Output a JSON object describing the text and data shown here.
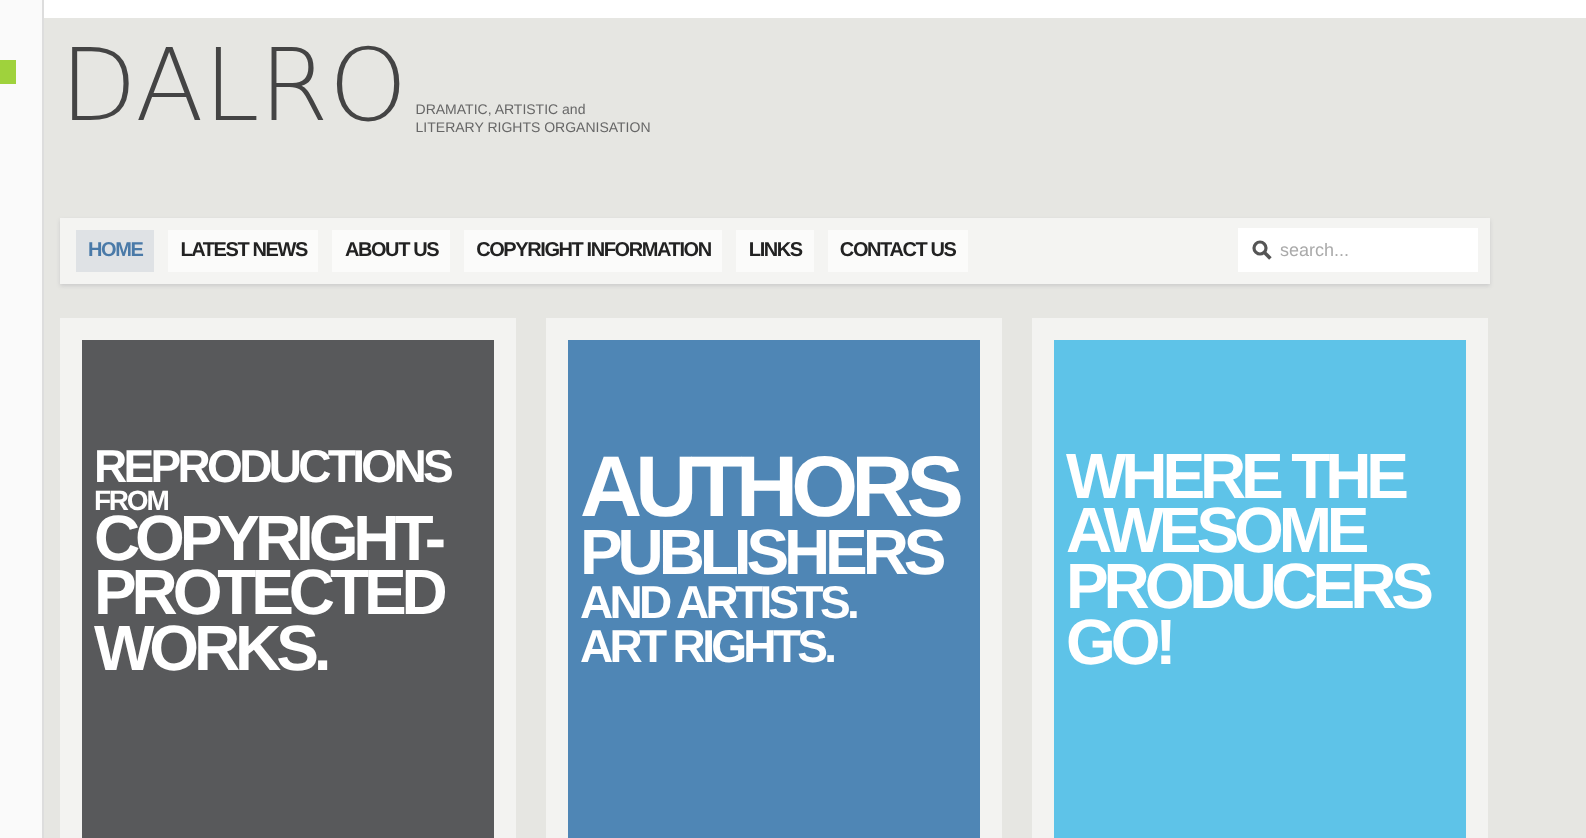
{
  "logo": {
    "text": "DALRO",
    "tagline_line_1": "DRAMATIC, ARTISTIC and",
    "tagline_line_2": "LITERARY RIGHTS ORGANISATION"
  },
  "nav": {
    "items": [
      {
        "label": "HOME",
        "selected": true
      },
      {
        "label": "LATEST NEWS",
        "selected": false
      },
      {
        "label": "ABOUT US",
        "selected": false
      },
      {
        "label": "COPYRIGHT INFORMATION",
        "selected": false
      },
      {
        "label": "LINKS",
        "selected": false
      },
      {
        "label": "CONTACT US",
        "selected": false
      }
    ],
    "search": {
      "placeholder": "search..."
    }
  },
  "posters": [
    {
      "color": "#58595b",
      "lines": [
        {
          "text": "REPRODUCTIONS",
          "kind": "medium"
        },
        {
          "text": "FROM",
          "kind": "small"
        },
        {
          "text": "COPYRIGHT-",
          "kind": "large"
        },
        {
          "text": "PROTECTED",
          "kind": "large"
        },
        {
          "text": "WORKS.",
          "kind": "large"
        }
      ]
    },
    {
      "color": "#4f86b5",
      "lines": [
        {
          "text": "AUTHORS",
          "kind": "huge"
        },
        {
          "text": "PUBLISHERS",
          "kind": "large"
        },
        {
          "text": "AND ARTISTS.",
          "kind": "medium"
        },
        {
          "text": "ART RIGHTS.",
          "kind": "medium"
        }
      ]
    },
    {
      "color": "#5ec3e8",
      "lines": [
        {
          "text": "WHERE THE",
          "kind": "large"
        },
        {
          "text": "AWESOME",
          "kind": "large"
        },
        {
          "text": "PRODUCERS",
          "kind": "large"
        },
        {
          "text": "GO!",
          "kind": "large"
        }
      ]
    }
  ]
}
